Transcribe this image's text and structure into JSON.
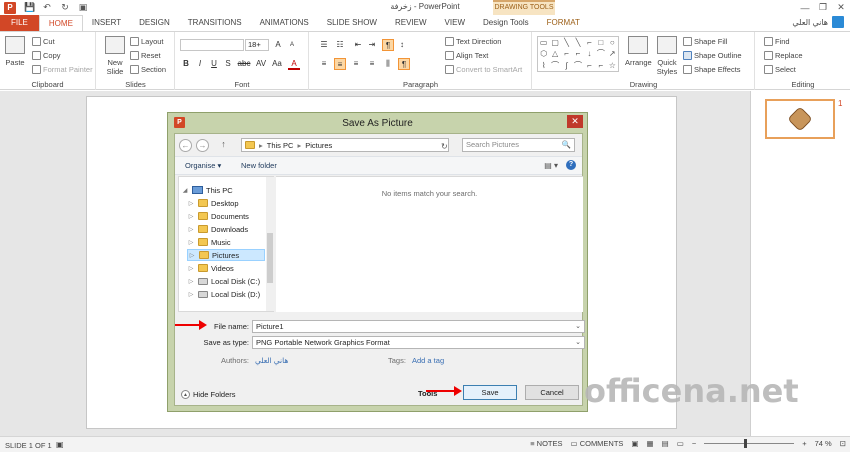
{
  "titlebar": {
    "app_title": "زخرفة - PowerPoint",
    "drawing_tools": "DRAWING TOOLS",
    "minimize": "—",
    "restore": "❐",
    "close": "✕"
  },
  "quick_access": {
    "save": "💾",
    "undo": "↶",
    "redo": "↻",
    "present": "▣"
  },
  "tabs": [
    "FILE",
    "HOME",
    "INSERT",
    "DESIGN",
    "TRANSITIONS",
    "ANIMATIONS",
    "SLIDE SHOW",
    "REVIEW",
    "VIEW",
    "Design Tools",
    "FORMAT"
  ],
  "user": {
    "name": "هاني العلي"
  },
  "ribbon": {
    "clipboard": {
      "label": "Clipboard",
      "paste": "Paste",
      "cut": "Cut",
      "copy": "Copy",
      "format_painter": "Format Painter"
    },
    "slides": {
      "label": "Slides",
      "new_slide": "New Slide",
      "layout": "Layout",
      "reset": "Reset",
      "section": "Section"
    },
    "font": {
      "label": "Font",
      "font_name": "",
      "font_size": "18+",
      "bold": "B",
      "italic": "I",
      "underline": "U",
      "strike": "S",
      "shadow": "abc",
      "spacing": "AV",
      "case": "Aa",
      "color": "A",
      "grow": "A",
      "shrink": "A"
    },
    "paragraph": {
      "label": "Paragraph",
      "text_direction": "Text Direction",
      "align_text": "Align Text",
      "convert_smartart": "Convert to SmartArt"
    },
    "drawing": {
      "label": "Drawing",
      "arrange": "Arrange",
      "quick_styles": "Quick Styles",
      "shape_fill": "Shape Fill",
      "shape_outline": "Shape Outline",
      "shape_effects": "Shape Effects"
    },
    "editing": {
      "label": "Editing",
      "find": "Find",
      "replace": "Replace",
      "select": "Select"
    }
  },
  "shape_glyphs": [
    "▭",
    "▢",
    "╲",
    "╲",
    "⌐",
    "□",
    "○",
    "⬡",
    "△",
    "⌐",
    "⌐",
    "↓",
    "⌒",
    "↗",
    "⌇",
    "⌒",
    "∫",
    "⌒",
    "⌐",
    "⌐",
    "☆"
  ],
  "thumbnails": {
    "slide_number": "1"
  },
  "dialog": {
    "title": "Save As Picture",
    "close": "✕",
    "nav": {
      "back": "←",
      "forward": "→",
      "up": "↑",
      "path": [
        "This PC",
        "Pictures"
      ],
      "refresh": "↻",
      "search_placeholder": "Search Pictures",
      "search_icon": "🔍"
    },
    "commands": {
      "organise": "Organise ▾",
      "new_folder": "New folder",
      "view": "▤ ▾",
      "help": "?"
    },
    "tree": [
      {
        "label": "This PC",
        "icon": "pc-icon",
        "expander": "◢"
      },
      {
        "label": "Desktop",
        "icon": "folder-icon",
        "expander": "▷"
      },
      {
        "label": "Documents",
        "icon": "folder-icon",
        "expander": "▷"
      },
      {
        "label": "Downloads",
        "icon": "folder-icon",
        "expander": "▷"
      },
      {
        "label": "Music",
        "icon": "folder-icon",
        "expander": "▷"
      },
      {
        "label": "Pictures",
        "icon": "folder-icon",
        "expander": "▷"
      },
      {
        "label": "Videos",
        "icon": "folder-icon",
        "expander": "▷"
      },
      {
        "label": "Local Disk (C:)",
        "icon": "drive-icon",
        "expander": "▷"
      },
      {
        "label": "Local Disk (D:)",
        "icon": "drive-icon",
        "expander": "▷"
      }
    ],
    "selected_tree_index": 5,
    "empty_message": "No items match your search.",
    "file_name_label": "File name:",
    "file_name_value": "Picture1",
    "save_as_type_label": "Save as type:",
    "save_as_type_value": "PNG Portable Network Graphics Format",
    "authors_label": "Authors:",
    "authors_value": "هاني العلي",
    "tags_label": "Tags:",
    "tags_value": "Add a tag",
    "hide_folders": "Hide Folders",
    "tools": "Tools",
    "save": "Save",
    "cancel": "Cancel",
    "dropdown_glyph": "⌄"
  },
  "watermark": "officena.net",
  "status": {
    "slide": "SLIDE 1 OF 1",
    "notes": "NOTES",
    "comments": "COMMENTS",
    "zoom": "74 %",
    "minus": "−",
    "plus": "+"
  },
  "colors": {
    "accent": "#d24726",
    "drawing_tools": "#f7e4c2",
    "dialog_frame": "#c7d3ac",
    "arrow": "#e00000"
  }
}
